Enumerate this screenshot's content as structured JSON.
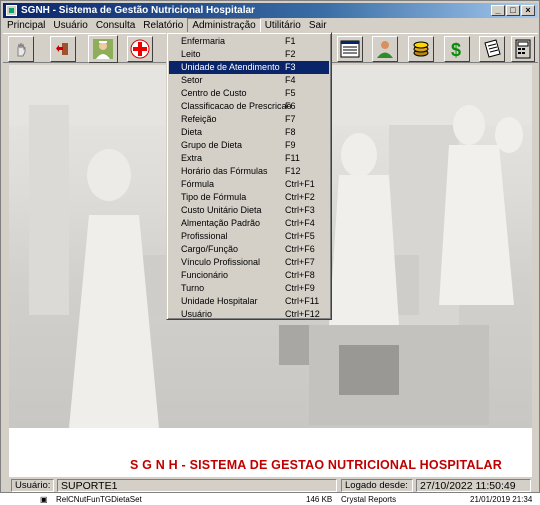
{
  "window": {
    "title": "SGNH - Sistema de Gestão Nutricional Hospitalar",
    "controls": [
      "_",
      "□",
      "×"
    ]
  },
  "menubar": {
    "items": [
      "Principal",
      "Usuário",
      "Consulta",
      "Relatório",
      "Administração",
      "Utilitário",
      "Sair"
    ],
    "open": "Administração"
  },
  "toolbar": {
    "buttons": [
      "hand-icon",
      "exit-door-icon",
      "nurse-icon",
      "red-cross-icon",
      "window-list-icon",
      "user-green-icon",
      "coins-icon",
      "dollar-icon",
      "checklist-icon",
      "calculator-icon"
    ]
  },
  "dropdown": {
    "items": [
      {
        "label": "Enfermaria",
        "shortcut": "F1"
      },
      {
        "label": "Leito",
        "shortcut": "F2"
      },
      {
        "label": "Unidade de Atendimento",
        "shortcut": "F3"
      },
      {
        "label": "Setor",
        "shortcut": "F4"
      },
      {
        "label": "Centro de Custo",
        "shortcut": "F5"
      },
      {
        "label": "Classificacao de Prescricao",
        "shortcut": "F6"
      },
      {
        "label": "Refeição",
        "shortcut": "F7"
      },
      {
        "label": "Dieta",
        "shortcut": "F8"
      },
      {
        "label": "Grupo de Dieta",
        "shortcut": "F9"
      },
      {
        "label": "Extra",
        "shortcut": "F11"
      },
      {
        "label": "Horário das Fórmulas",
        "shortcut": "F12"
      },
      {
        "label": "Fórmula",
        "shortcut": "Ctrl+F1"
      },
      {
        "label": "Tipo de Fórmula",
        "shortcut": "Ctrl+F2"
      },
      {
        "label": "Custo Unitário Dieta",
        "shortcut": "Ctrl+F3"
      },
      {
        "label": "Almentação Padrão",
        "shortcut": "Ctrl+F4"
      },
      {
        "label": "Profissional",
        "shortcut": "Ctrl+F5"
      },
      {
        "label": "Cargo/Função",
        "shortcut": "Ctrl+F6"
      },
      {
        "label": "Vínculo Profissional",
        "shortcut": "Ctrl+F7"
      },
      {
        "label": "Funcionário",
        "shortcut": "Ctrl+F8"
      },
      {
        "label": "Turno",
        "shortcut": "Ctrl+F9"
      },
      {
        "label": "Unidade Hospitalar",
        "shortcut": "Ctrl+F11"
      },
      {
        "label": "Usuário",
        "shortcut": "Ctrl+F12"
      }
    ],
    "highlighted": "Unidade de Atendimento"
  },
  "banner": {
    "text": "S G N H  - SISTEMA DE GESTAO NUTRICIONAL HOSPITALAR"
  },
  "statusbar": {
    "user_label": "Usuário:",
    "user_value": "SUPORTE1",
    "logged_label": "Logado desde:",
    "logged_value": "27/10/2022  11:50:49"
  },
  "background_row": {
    "name": "RelCNutFunTGDietaSet",
    "size": "146 KB",
    "type": "Crystal Reports",
    "date": "21/01/2019 21:34"
  },
  "colors": {
    "title_start": "#0a246a",
    "title_end": "#a6caf0",
    "banner_text": "#c00000",
    "menu_highlight": "#0a246a"
  }
}
